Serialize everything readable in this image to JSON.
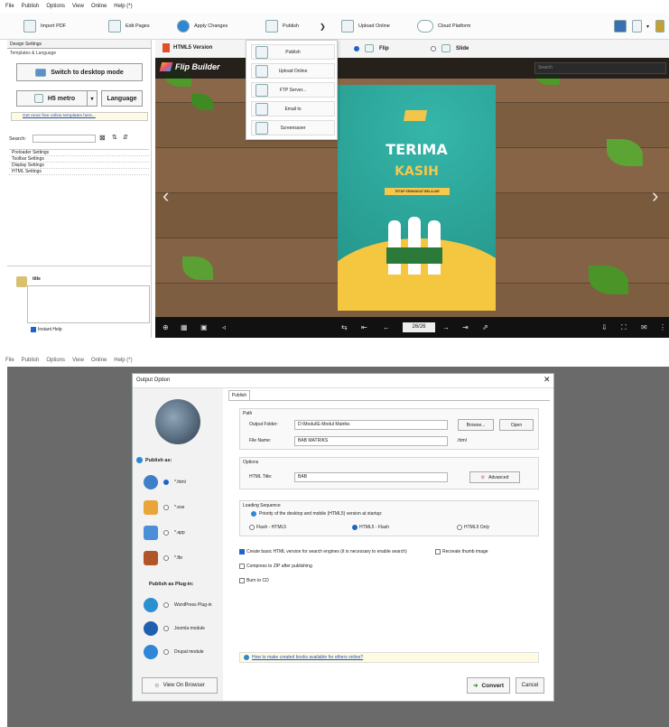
{
  "menu": {
    "items": [
      "File",
      "Publish",
      "Options",
      "View",
      "Online",
      "Help (*)"
    ]
  },
  "toolbar": {
    "import_pdf": "Import PDF",
    "edit_pages": "Edit Pages",
    "apply_changes": "Apply Changes",
    "publish": "Publish",
    "upload_online": "Upload Online",
    "cloud_platform": "Cloud Platform"
  },
  "design": {
    "tab": "Design Settings",
    "section": "Templates & Language",
    "switch_btn": "Switch to desktop mode",
    "h5_btn": "H5 metro",
    "lang_btn": "Language",
    "more_link": "Get more free online templates here...",
    "search_label": "Search:",
    "tree": [
      "Preloader Settings",
      "Toolbar Settings",
      "Display Settings",
      "HTML Settings"
    ],
    "title_label": "title",
    "instant_help": "Instant Help"
  },
  "viewer": {
    "html5_version": "HTML5 Version",
    "flip": "Flip",
    "slide": "Slide",
    "brand": "Flip Builder",
    "search_placeholder": "Search",
    "page_counter": "26/26"
  },
  "cover": {
    "line1": "TERIMA",
    "line2": "KASIH",
    "banner": "TETAP SEMANGAT BELAJAR"
  },
  "publish_menu": {
    "items": [
      "Publish",
      "Upload Online",
      "FTP Server...",
      "Email to",
      "Screensaver"
    ]
  },
  "menu2": {
    "items": [
      "File",
      "Publish",
      "Options",
      "View",
      "Online",
      "Help (*)"
    ]
  },
  "dialog": {
    "title": "Output Option",
    "tab": "Publish",
    "publish_as": "Publish as:",
    "targets": [
      "*.html",
      "*.exe",
      "*.app",
      "*.fbr"
    ],
    "plugin_heading": "Publish as Plug-in:",
    "plugins": [
      "WordPress Plug-in",
      "Joomla module",
      "Drupal module"
    ],
    "path_group": "Path",
    "output_folder_label": "Output Folder:",
    "output_folder_value": "D:\\Modul\\E-Modul Matriks",
    "browse": "Browse...",
    "open": "Open",
    "file_name_label": "File Name:",
    "file_name_value": "BAB MATRIKS",
    "file_ext": ".html",
    "options_group": "Options",
    "html_title_label": "HTML Title:",
    "html_title_value": "BAB",
    "advanced": "Advanced",
    "loading_group": "Loading Sequence",
    "priority_text": "Priority of the desktop and mobile (HTML5) version at startup:",
    "loading_options": [
      "Flash - HTML5",
      "HTML5 - Flash",
      "HTML5 Only"
    ],
    "check_basic": "Create basic HTML version for search engines (it is necessary to enable search)",
    "check_thumb": "Recreate thumb image",
    "check_zip": "Compress to ZIP after publishing",
    "check_cd": "Burn to CD",
    "help_link": "How to make created books available for others online?",
    "view_browser": "View On Browser",
    "convert": "Convert",
    "cancel": "Cancel"
  },
  "colors": {
    "accent": "#1e63c8",
    "dark_bg": "#6a6a6a",
    "teal": "#28a79b",
    "wood": "#7b5b3e"
  }
}
